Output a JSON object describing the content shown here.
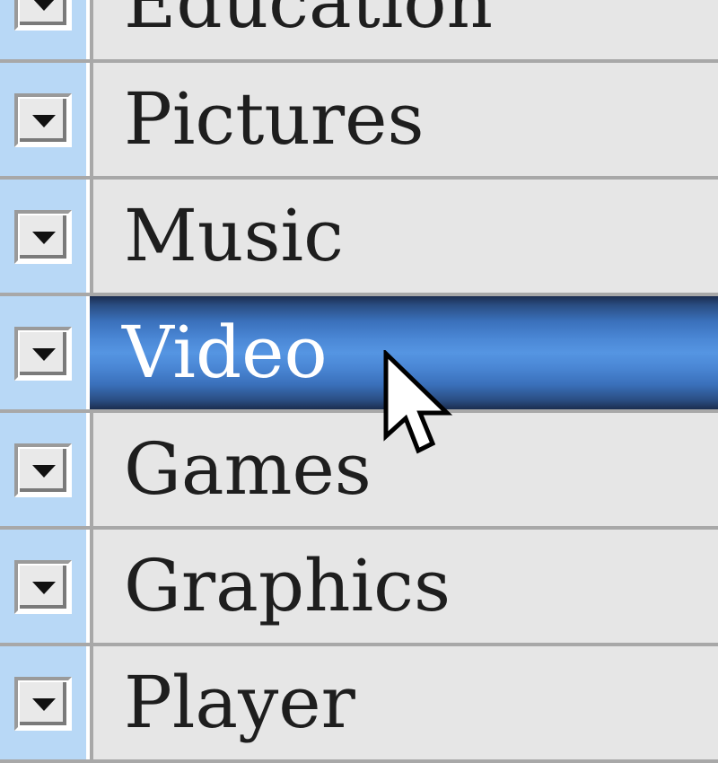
{
  "menu": {
    "items": [
      {
        "label": "Education",
        "selected": false
      },
      {
        "label": "Pictures",
        "selected": false
      },
      {
        "label": "Music",
        "selected": false
      },
      {
        "label": "Video",
        "selected": true
      },
      {
        "label": "Games",
        "selected": false
      },
      {
        "label": "Graphics",
        "selected": false
      },
      {
        "label": "Player",
        "selected": false
      }
    ]
  },
  "colors": {
    "gutter": "#b8d8f6",
    "cell_background": "#e6e6e6",
    "selection_mid": "#5595e2",
    "selection_edge": "#1b2d4f",
    "text": "#1e1e1e",
    "selected_text": "#ffffff"
  },
  "icons": {
    "row_toggle": "chevron-down-icon",
    "pointer": "mouse-pointer-icon"
  }
}
